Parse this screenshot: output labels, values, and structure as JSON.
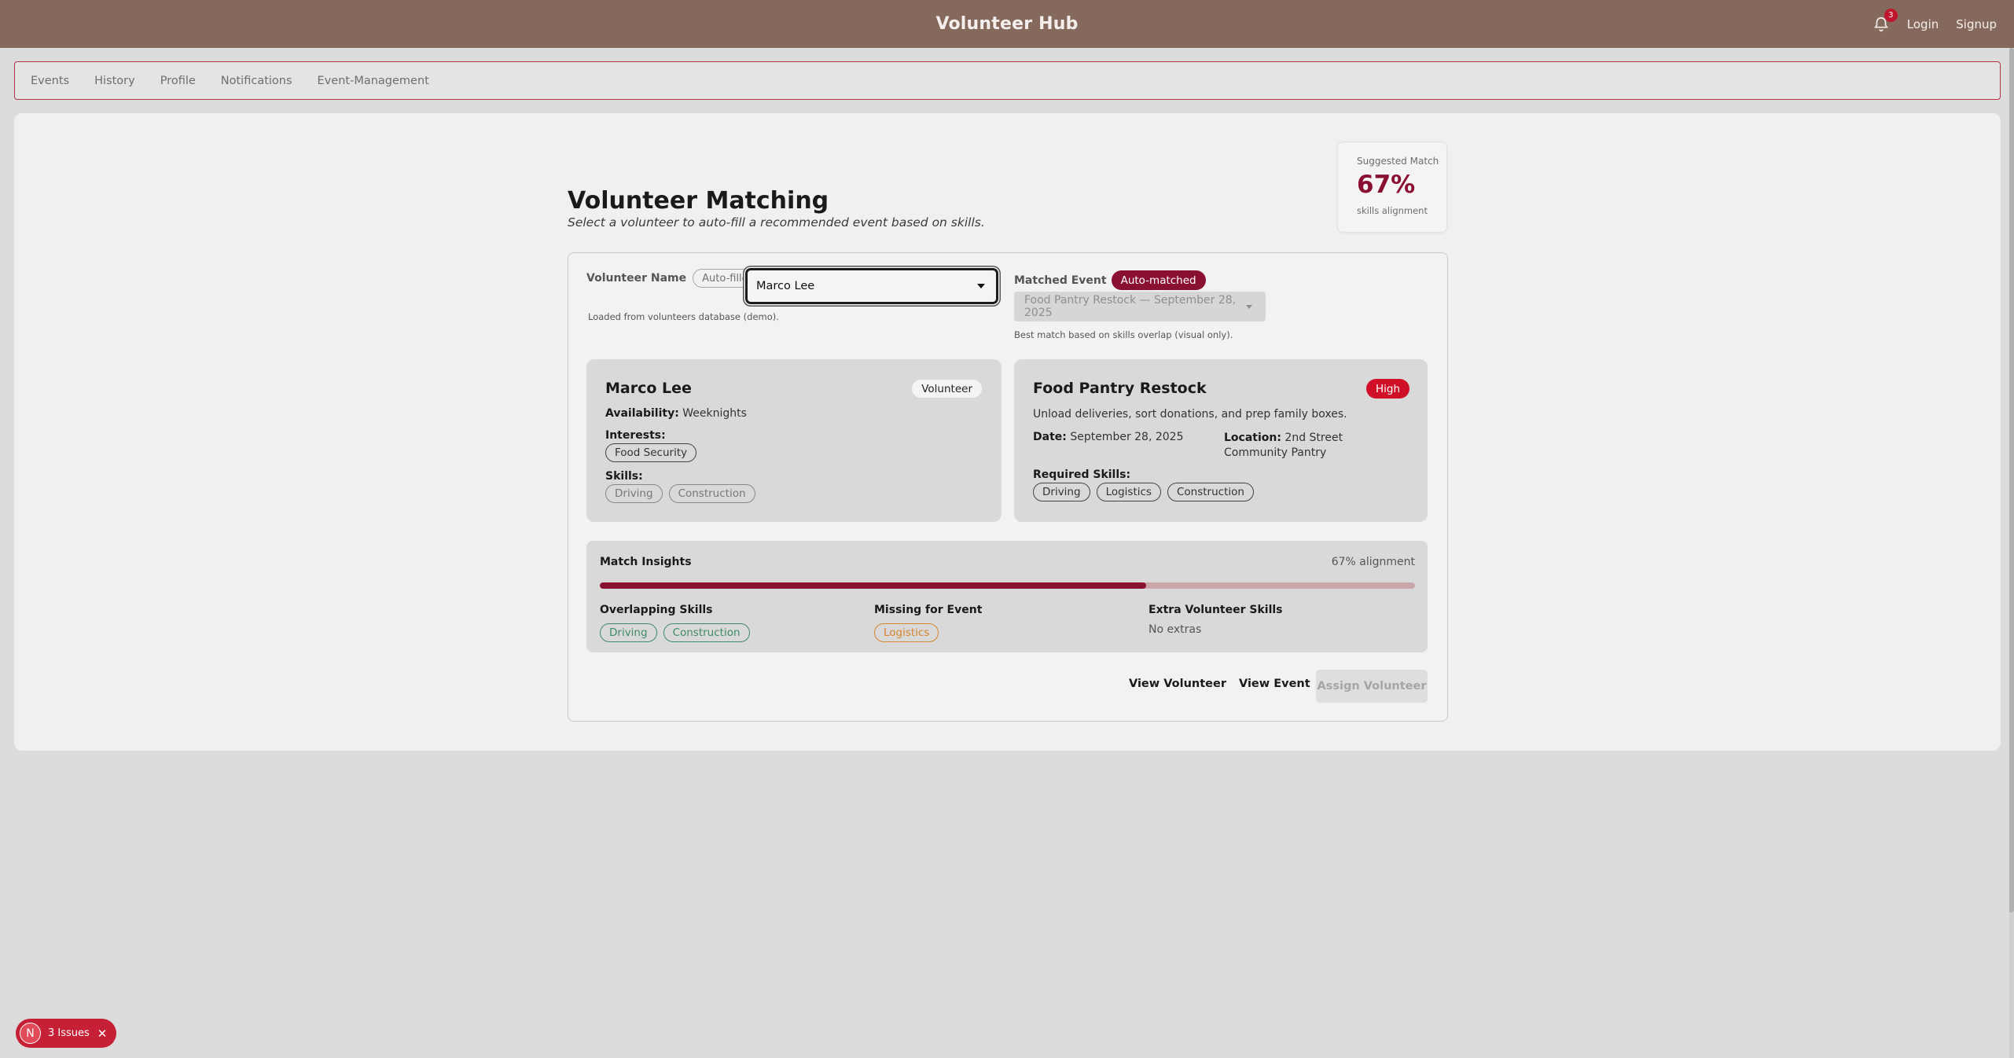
{
  "header": {
    "title": "Volunteer Hub",
    "notification_count": "3",
    "login_label": "Login",
    "signup_label": "Signup",
    "bg_color": "#86695d"
  },
  "nav": {
    "items": [
      {
        "label": "Events"
      },
      {
        "label": "History"
      },
      {
        "label": "Profile"
      },
      {
        "label": "Notifications"
      },
      {
        "label": "Event-Management"
      }
    ]
  },
  "suggested_match": {
    "label": "Suggested Match",
    "percent": "67%",
    "sub": "skills alignment"
  },
  "page": {
    "title": "Volunteer Matching",
    "subtitle": "Select a volunteer to auto-fill a recommended event based on skills."
  },
  "form": {
    "volunteer_label": "Volunteer Name",
    "volunteer_chip": "Auto-filled",
    "volunteer_value": "Marco Lee",
    "volunteer_help": "Loaded from volunteers database (demo).",
    "event_label": "Matched Event",
    "event_chip": "Auto-matched",
    "event_value": "Food Pantry Restock — September 28, 2025",
    "event_help": "Best match based on skills overlap (visual only)."
  },
  "volunteer": {
    "name": "Marco Lee",
    "role": "Volunteer",
    "availability_label": "Availability:",
    "availability": "Weeknights",
    "interests_label": "Interests:",
    "interests": [
      "Food Security"
    ],
    "skills_label": "Skills:",
    "skills": [
      "Driving",
      "Construction"
    ]
  },
  "event": {
    "name": "Food Pantry Restock",
    "priority": "High",
    "description": "Unload deliveries, sort donations, and prep family boxes.",
    "date_label": "Date:",
    "date": "September 28, 2025",
    "location_label": "Location:",
    "location": "2nd Street Community Pantry",
    "required_label": "Required Skills:",
    "required_skills": [
      "Driving",
      "Logistics",
      "Construction"
    ]
  },
  "insights": {
    "title": "Match Insights",
    "alignment_text": "67% alignment",
    "alignment_fraction": 0.67,
    "overlap_title": "Overlapping Skills",
    "overlap": [
      "Driving",
      "Construction"
    ],
    "missing_title": "Missing for Event",
    "missing": [
      "Logistics"
    ],
    "extra_title": "Extra Volunteer Skills",
    "extra_none": "No extras"
  },
  "actions": {
    "view_volunteer": "View Volunteer",
    "view_event": "View Event",
    "assign": "Assign Volunteer"
  },
  "issues": {
    "logo": "N",
    "label": "3 Issues",
    "close": "✕"
  },
  "colors": {
    "accent": "#8a1032",
    "priority_high": "#cf1026",
    "overlap": "#3e8a67",
    "missing": "#d7842d"
  }
}
